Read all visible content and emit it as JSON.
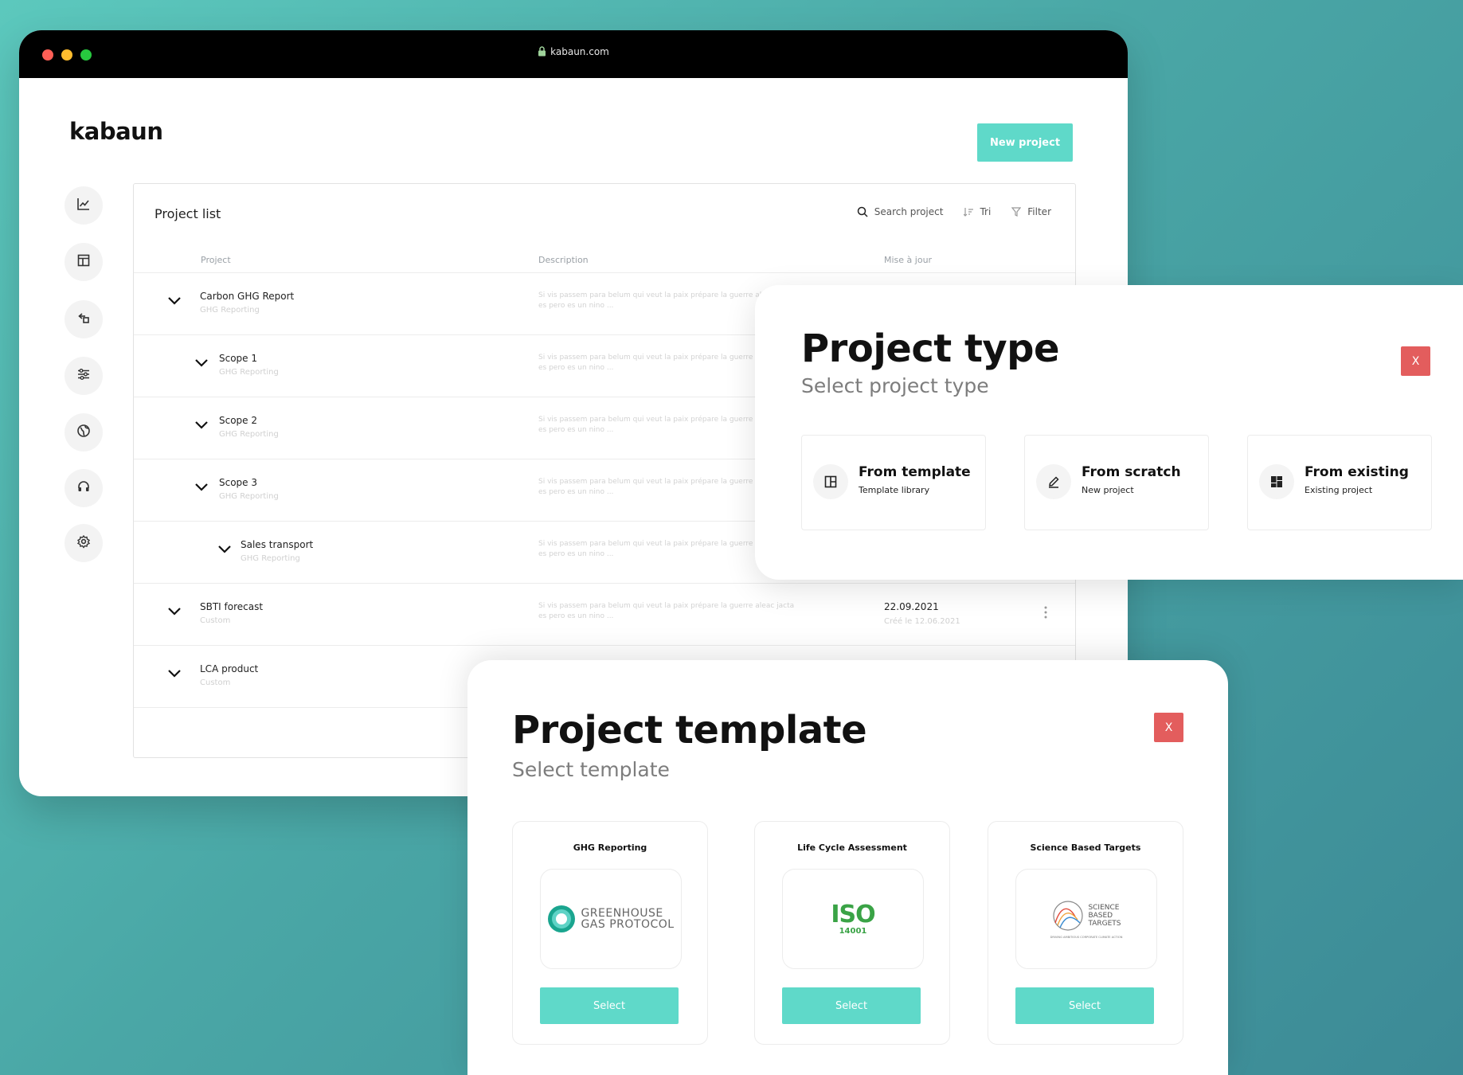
{
  "browser": {
    "url": "kabaun.com"
  },
  "app": {
    "logo": "kabaun",
    "new_project_label": "New project"
  },
  "sidebar": {
    "items": [
      {
        "icon": "chart-icon"
      },
      {
        "icon": "layout-icon"
      },
      {
        "icon": "return-icon"
      },
      {
        "icon": "sliders-icon"
      },
      {
        "icon": "globe-icon"
      },
      {
        "icon": "headset-icon"
      },
      {
        "icon": "settings-icon"
      }
    ]
  },
  "project_list": {
    "title": "Project list",
    "search_placeholder": "Search project",
    "sort_label": "Tri",
    "filter_label": "Filter",
    "columns": {
      "project": "Project",
      "description": "Description",
      "updated": "Mise à jour"
    },
    "rows": [
      {
        "name": "Carbon GHG Report",
        "type": "GHG Reporting",
        "description": "Si vis passem para belum qui veut la paix prépare la guerre aleac jacta es pero es un nino ...",
        "date": "",
        "created": ""
      },
      {
        "name": "Scope 1",
        "type": "GHG Reporting",
        "description": "Si vis passem para belum qui veut la paix prépare la guerre aleac jacta es pero es un nino ...",
        "date": "",
        "created": ""
      },
      {
        "name": "Scope 2",
        "type": "GHG Reporting",
        "description": "Si vis passem para belum qui veut la paix prépare la guerre aleac jacta es pero es un nino ...",
        "date": "",
        "created": ""
      },
      {
        "name": "Scope 3",
        "type": "GHG Reporting",
        "description": "Si vis passem para belum qui veut la paix prépare la guerre aleac jacta es pero es un nino ...",
        "date": "",
        "created": ""
      },
      {
        "name": "Sales transport",
        "type": "GHG Reporting",
        "description": "Si vis passem para belum qui veut la paix prépare la guerre aleac jacta es pero es un nino ...",
        "date": "",
        "created": ""
      },
      {
        "name": "SBTI forecast",
        "type": "Custom",
        "description": "Si vis passem para belum qui veut la paix prépare la guerre aleac jacta es pero es un nino ...",
        "date": "22.09.2021",
        "created": "Créé le 12.06.2021"
      },
      {
        "name": "LCA product",
        "type": "Custom",
        "description": "",
        "date": "",
        "created": ""
      }
    ]
  },
  "project_type_modal": {
    "title": "Project type",
    "subtitle": "Select project type",
    "close_label": "X",
    "options": [
      {
        "title": "From template",
        "subtitle": "Template library",
        "icon": "template-icon"
      },
      {
        "title": "From scratch",
        "subtitle": "New project",
        "icon": "pencil-icon"
      },
      {
        "title": "From existing",
        "subtitle": "Existing project",
        "icon": "grid-icon"
      }
    ]
  },
  "project_template_modal": {
    "title": "Project template",
    "subtitle": "Select template",
    "close_label": "X",
    "templates": [
      {
        "title": "GHG Reporting",
        "logo_lines": [
          "GREENHOUSE",
          "GAS PROTOCOL"
        ],
        "select_label": "Select"
      },
      {
        "title": "Life Cycle Assessment",
        "logo_main": "ISO",
        "logo_sub": "14001",
        "select_label": "Select"
      },
      {
        "title": "Science Based Targets",
        "logo_lines": [
          "SCIENCE",
          "BASED",
          "TARGETS"
        ],
        "logo_tagline": "DRIVING AMBITIOUS CORPORATE CLIMATE ACTION",
        "select_label": "Select"
      }
    ]
  },
  "colors": {
    "accent": "#5fd9c9",
    "close": "#e35d5d",
    "background": "#4aa7a6"
  }
}
